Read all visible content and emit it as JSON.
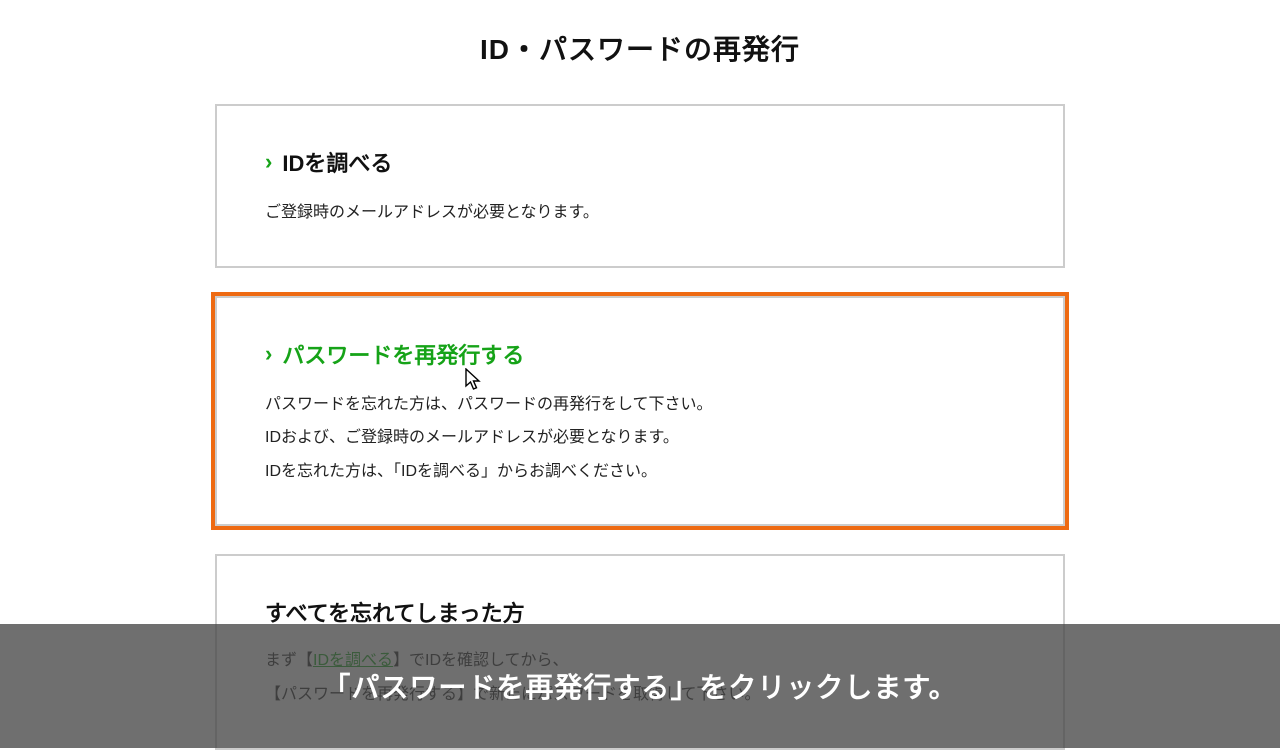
{
  "page": {
    "title": "ID・パスワードの再発行"
  },
  "cards": {
    "lookup_id": {
      "link_label": "IDを調べる",
      "desc1": "ご登録時のメールアドレスが必要となります。"
    },
    "reissue_pw": {
      "link_label": "パスワードを再発行する",
      "desc1": "パスワードを忘れた方は、パスワードの再発行をして下さい。",
      "desc2": "IDおよび、ご登録時のメールアドレスが必要となります。",
      "desc3": "IDを忘れた方は、「IDを調べる」からお調べください。"
    },
    "forgot_all": {
      "heading": "すべてを忘れてしまった方",
      "pre1": "まず【",
      "link1": "IDを調べる",
      "post1": "】でIDを確認してから、",
      "line2": "【パスワードを再発行する】で新たにパスワードを取得して下さい。"
    }
  },
  "caption": {
    "text": "「パスワードを再発行する」をクリックします。"
  },
  "chevron": "›"
}
